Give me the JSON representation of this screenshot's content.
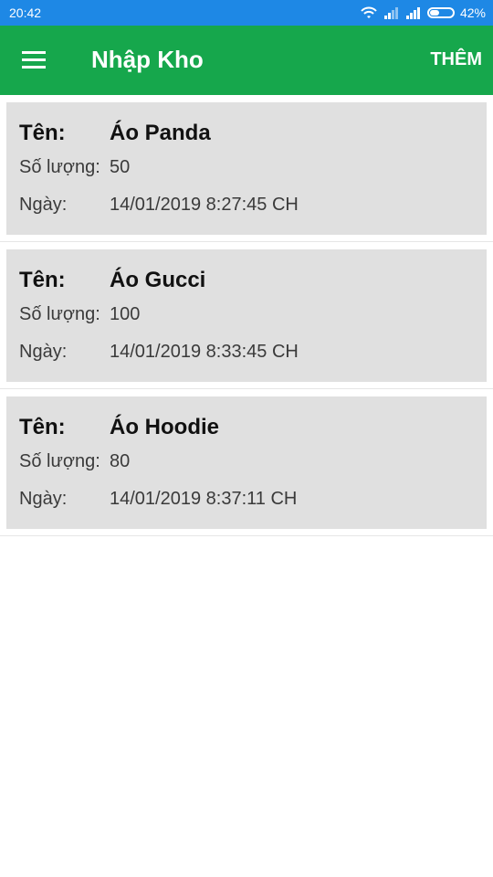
{
  "status_bar": {
    "time": "20:42",
    "battery_percent_text": "42%",
    "battery_level": 0.42
  },
  "app_bar": {
    "menu_icon": "hamburger-menu-icon",
    "title": "Nhập Kho",
    "action_label": "THÊM"
  },
  "labels": {
    "name": "Tên:",
    "quantity": "Số lượng:",
    "date": "Ngày:"
  },
  "items": [
    {
      "name": "Áo Panda",
      "quantity": "50",
      "date": "14/01/2019 8:27:45 CH"
    },
    {
      "name": "Áo Gucci",
      "quantity": "100",
      "date": "14/01/2019 8:33:45 CH"
    },
    {
      "name": "Áo Hoodie",
      "quantity": "80",
      "date": "14/01/2019 8:37:11 CH"
    }
  ],
  "colors": {
    "status_bar": "#1e88e5",
    "app_bar": "#16a74c",
    "card": "#e0e0e0"
  }
}
